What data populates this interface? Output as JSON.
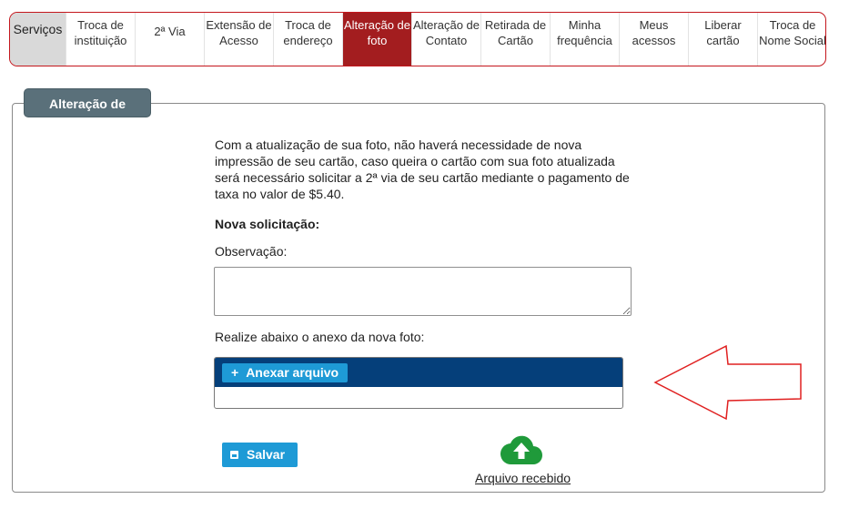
{
  "tabs": [
    {
      "label": "Serviços",
      "width": 62
    },
    {
      "label": "Troca de instituição",
      "width": 76
    },
    {
      "label": "2ª Via",
      "width": 76
    },
    {
      "label": "Extensão de Acesso",
      "width": 76
    },
    {
      "label": "Troca de endereço",
      "width": 76
    },
    {
      "label": "Alteração de foto",
      "width": 76
    },
    {
      "label": "Alteração de Contato",
      "width": 76
    },
    {
      "label": "Retirada de Cartão",
      "width": 76
    },
    {
      "label": "Minha frequência",
      "width": 76
    },
    {
      "label": "Meus acessos",
      "width": 76
    },
    {
      "label": "Liberar cartão",
      "width": 76
    },
    {
      "label": "Troca de Nome Social",
      "width": 76
    }
  ],
  "active_tab": "Alteração de foto",
  "panel": {
    "title": "Alteração de foto",
    "intro": "Com a atualização de sua foto, não haverá necessidade de nova impressão de seu cartão, caso queira o cartão com sua foto atualizada será necessário solicitar a 2ª via de seu cartão mediante o pagamento de taxa no valor de $5.40.",
    "new_request_label": "Nova solicitação:",
    "observation_label": "Observação:",
    "observation_value": "",
    "attach_prompt": "Realize abaixo o anexo da nova foto:",
    "attach_button": "Anexar arquivo",
    "attach_icon": "plus-icon",
    "save_button": "Salvar",
    "save_icon": "floppy-disk-icon",
    "received_link": "Arquivo recebido",
    "received_icon": "cloud-upload-icon"
  },
  "colors": {
    "tab_border": "#c4161c",
    "tab_active_bg": "#a31d1f",
    "panel_title_bg": "#5a707a",
    "upload_header_bg": "#053f7a",
    "button_bg": "#1e9ad6",
    "cloud_icon": "#1f9a3a",
    "arrow_stroke": "#e02020"
  }
}
